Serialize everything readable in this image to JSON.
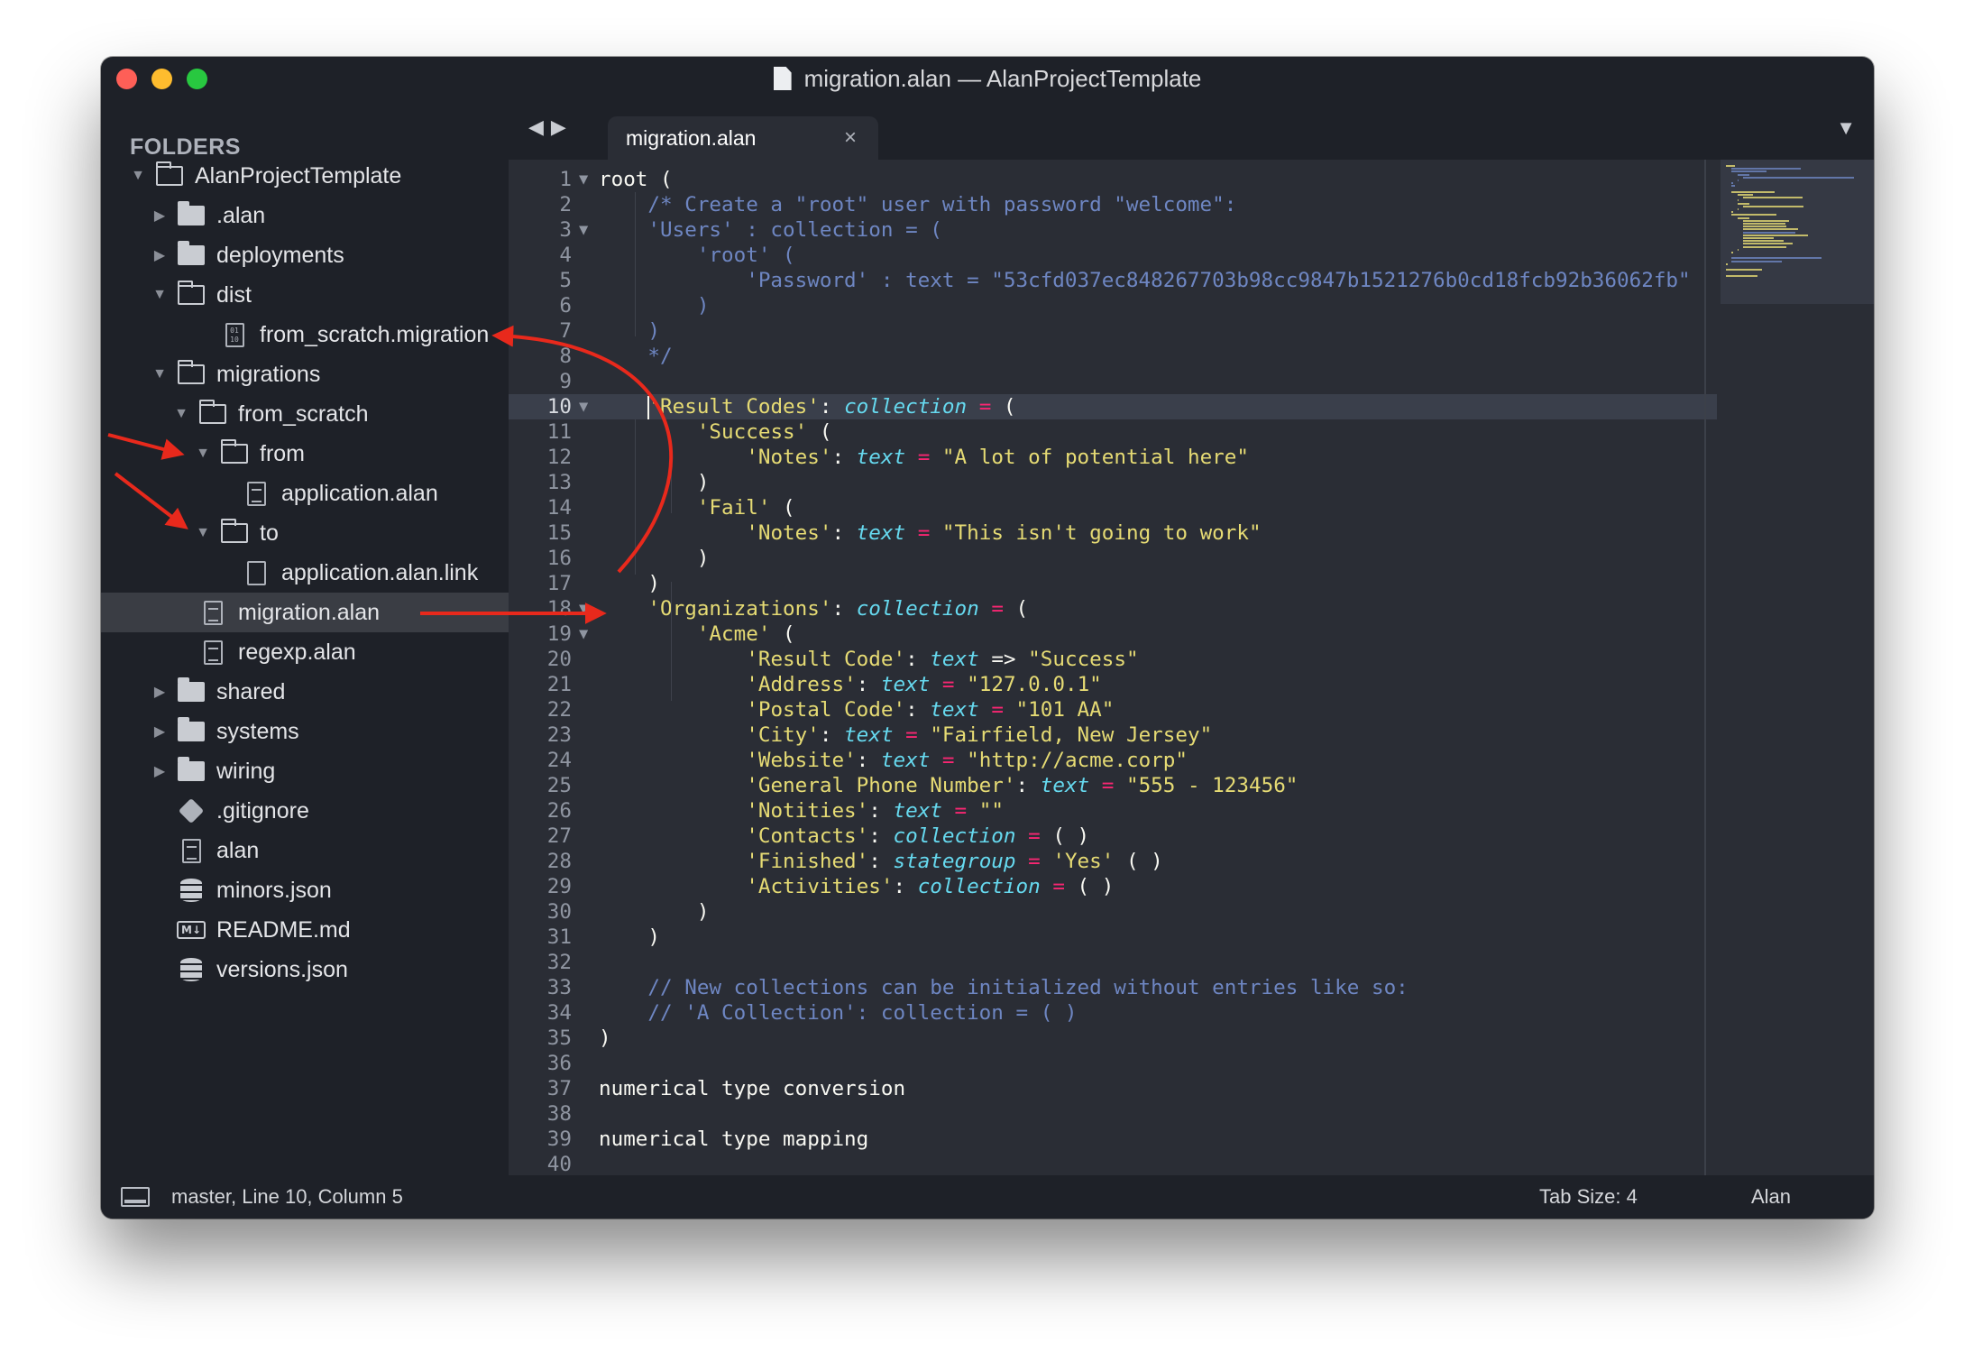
{
  "window": {
    "title": "migration.alan — AlanProjectTemplate",
    "colors": {
      "accent_arrow": "#e8291c",
      "editor_bg": "#2a2d35",
      "sidebar_bg": "#1e2128"
    }
  },
  "sidebar": {
    "heading": "FOLDERS",
    "items": [
      {
        "label": "AlanProjectTemplate",
        "icon": "folder-open-icon",
        "expanded": true
      },
      {
        "label": ".alan",
        "icon": "folder-icon",
        "expanded": false
      },
      {
        "label": "deployments",
        "icon": "folder-icon",
        "expanded": false
      },
      {
        "label": "dist",
        "icon": "folder-open-icon",
        "expanded": true
      },
      {
        "label": "from_scratch.migration",
        "icon": "binary-file-icon"
      },
      {
        "label": "migrations",
        "icon": "folder-open-icon",
        "expanded": true
      },
      {
        "label": "from_scratch",
        "icon": "folder-open-icon",
        "expanded": true
      },
      {
        "label": "from",
        "icon": "folder-open-icon",
        "expanded": true
      },
      {
        "label": "application.alan",
        "icon": "file-icon"
      },
      {
        "label": "to",
        "icon": "folder-open-icon",
        "expanded": true
      },
      {
        "label": "application.alan.link",
        "icon": "file-blank-icon"
      },
      {
        "label": "migration.alan",
        "icon": "file-icon",
        "selected": true
      },
      {
        "label": "regexp.alan",
        "icon": "file-icon"
      },
      {
        "label": "shared",
        "icon": "folder-icon",
        "expanded": false
      },
      {
        "label": "systems",
        "icon": "folder-icon",
        "expanded": false
      },
      {
        "label": "wiring",
        "icon": "folder-icon",
        "expanded": false
      },
      {
        "label": ".gitignore",
        "icon": "git-icon"
      },
      {
        "label": "alan",
        "icon": "file-icon"
      },
      {
        "label": "minors.json",
        "icon": "database-icon"
      },
      {
        "label": "README.md",
        "icon": "markdown-icon"
      },
      {
        "label": "versions.json",
        "icon": "database-icon"
      }
    ]
  },
  "tabs": {
    "nav_back": "◀",
    "nav_forward": "▶",
    "active_tab": "migration.alan",
    "close": "×",
    "dropdown": "▼"
  },
  "editor": {
    "lines": [
      {
        "n": "1",
        "fold": "▼",
        "code": "root ("
      },
      {
        "n": "2",
        "code": "    /* Create a \"root\" user with password \"welcome\":"
      },
      {
        "n": "3",
        "fold": "▼",
        "code": "    'Users' : collection = ("
      },
      {
        "n": "4",
        "code": "        'root' ("
      },
      {
        "n": "5",
        "code": "            'Password' : text = \"53cfd037ec848267703b98cc9847b1521276b0cd18fcb92b36062fb\""
      },
      {
        "n": "6",
        "code": "        )"
      },
      {
        "n": "7",
        "code": "    )"
      },
      {
        "n": "8",
        "code": "    */"
      },
      {
        "n": "9",
        "code": ""
      },
      {
        "n": "10",
        "fold": "▼",
        "code": "    'Result Codes': collection = ("
      },
      {
        "n": "11",
        "code": "        'Success' ("
      },
      {
        "n": "12",
        "code": "            'Notes': text = \"A lot of potential here\""
      },
      {
        "n": "13",
        "code": "        )"
      },
      {
        "n": "14",
        "code": "        'Fail' ("
      },
      {
        "n": "15",
        "code": "            'Notes': text = \"This isn't going to work\""
      },
      {
        "n": "16",
        "code": "        )"
      },
      {
        "n": "17",
        "code": "    )"
      },
      {
        "n": "18",
        "fold": "▼",
        "code": "    'Organizations': collection = ("
      },
      {
        "n": "19",
        "fold": "▼",
        "code": "        'Acme' ("
      },
      {
        "n": "20",
        "code": "            'Result Code': text => \"Success\""
      },
      {
        "n": "21",
        "code": "            'Address': text = \"127.0.0.1\""
      },
      {
        "n": "22",
        "code": "            'Postal Code': text = \"101 AA\""
      },
      {
        "n": "23",
        "code": "            'City': text = \"Fairfield, New Jersey\""
      },
      {
        "n": "24",
        "code": "            'Website': text = \"http://acme.corp\""
      },
      {
        "n": "25",
        "code": "            'General Phone Number': text = \"555 - 123456\""
      },
      {
        "n": "26",
        "code": "            'Notities': text = \"\""
      },
      {
        "n": "27",
        "code": "            'Contacts': collection = ( )"
      },
      {
        "n": "28",
        "code": "            'Finished': stategroup = 'Yes' ( )"
      },
      {
        "n": "29",
        "code": "            'Activities': collection = ( )"
      },
      {
        "n": "30",
        "code": "        )"
      },
      {
        "n": "31",
        "code": "    )"
      },
      {
        "n": "32",
        "code": ""
      },
      {
        "n": "33",
        "code": "    // New collections can be initialized without entries like so:"
      },
      {
        "n": "34",
        "code": "    // 'A Collection': collection = ( )"
      },
      {
        "n": "35",
        "code": ")"
      },
      {
        "n": "36",
        "code": ""
      },
      {
        "n": "37",
        "code": "numerical type conversion"
      },
      {
        "n": "38",
        "code": ""
      },
      {
        "n": "39",
        "code": "numerical type mapping"
      },
      {
        "n": "40",
        "code": ""
      }
    ]
  },
  "statusbar": {
    "position": "master, Line 10, Column 5",
    "tab_size": "Tab Size: 4",
    "syntax": "Alan"
  }
}
